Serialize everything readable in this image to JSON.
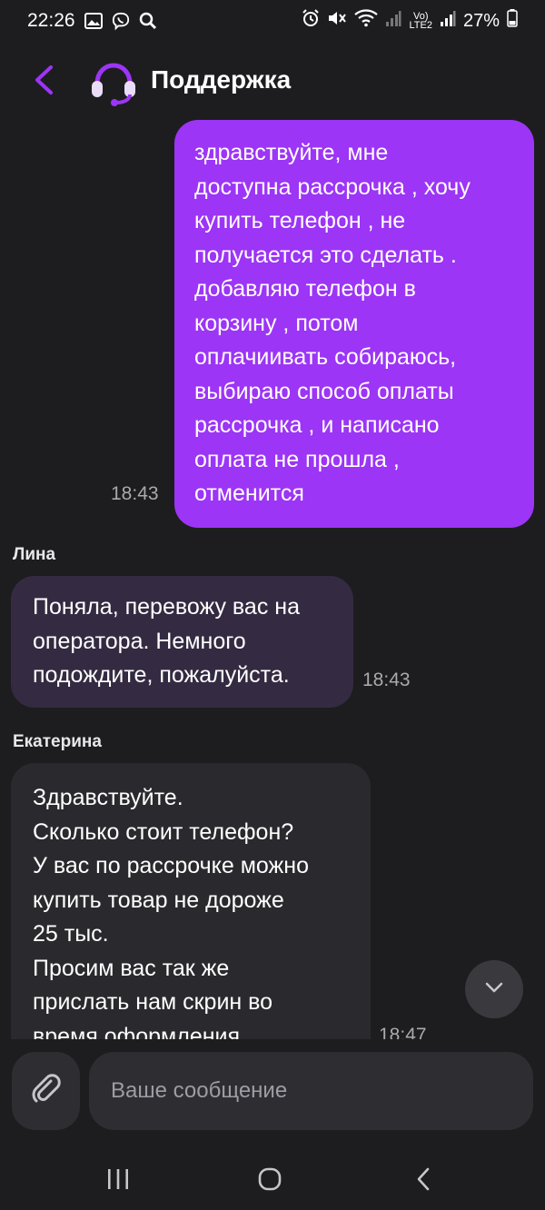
{
  "status_bar": {
    "time": "22:26",
    "network_label_top": "Vo)",
    "network_label_bottom": "LTE2",
    "battery": "27%"
  },
  "header": {
    "title": "Поддержка",
    "accent_color": "#9c35f5"
  },
  "messages": [
    {
      "direction": "outgoing",
      "text": "здравствуйте, мне\nдоступна рассрочка , хочу\nкупить телефон , не\nполучается это сделать .\nдобавляю телефон в\nкорзину , потом\nоплачиивать собираюсь,\nвыбираю способ оплаты\nрассрочка , и написано\nоплата не прошла ,\nотменится",
      "time": "18:43"
    },
    {
      "direction": "incoming",
      "sender": "Лина",
      "text": "Поняла, перевожу вас на\nоператора. Немного\nподождите, пожалуйста.",
      "time": "18:43"
    },
    {
      "direction": "incoming",
      "sender": "Екатерина",
      "text": "Здравствуйте.\nСколько стоит телефон?\nУ вас по рассрочке можно\nкупить товар не дороже\n25 тыс.\nПросим вас так же\nприслать нам скрин во\nвремя оформления.",
      "time": "18:47"
    }
  ],
  "composer": {
    "placeholder": "Ваше сообщение"
  },
  "icons": {
    "back": "chevron-left-icon",
    "avatar": "headset-icon",
    "attach": "paperclip-icon",
    "scroll": "chevron-down-icon"
  }
}
